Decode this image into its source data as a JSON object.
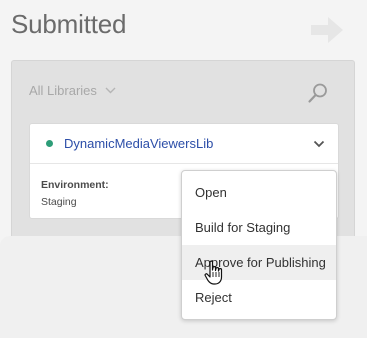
{
  "header": {
    "title": "Submitted",
    "forward_icon": "arrow-right-icon"
  },
  "filter": {
    "library_select_label": "All Libraries",
    "search_icon": "search-icon"
  },
  "library_card": {
    "name": "DynamicMediaViewersLib",
    "status_color": "#2d9d78",
    "environment_label": "Environment:",
    "environment_value": "Staging"
  },
  "context_menu": {
    "items": [
      {
        "label": "Open"
      },
      {
        "label": "Build for Staging"
      },
      {
        "label": "Approve for Publishing"
      },
      {
        "label": "Reject"
      }
    ],
    "hovered_item": "Approve for Publishing"
  },
  "colors": {
    "link": "#2c4ea8",
    "status_green": "#2d9d78",
    "panel_bg": "#e1e1e1"
  }
}
